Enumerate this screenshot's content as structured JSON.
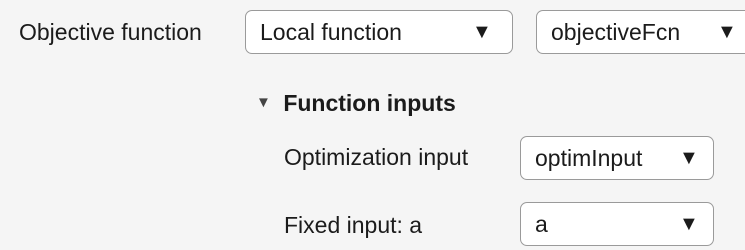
{
  "objective": {
    "label": "Objective function",
    "source": {
      "value": "Local function",
      "arrow_icon": "▼"
    },
    "function_name": {
      "value": "objectiveFcn",
      "arrow_icon": "▼"
    }
  },
  "function_inputs": {
    "toggle_icon": "▼",
    "title": "Function inputs",
    "optimization_input": {
      "label": "Optimization input",
      "value": "optimInput",
      "arrow_icon": "▼"
    },
    "fixed_input": {
      "label": "Fixed input: a",
      "value": "a",
      "arrow_icon": "▼"
    }
  }
}
